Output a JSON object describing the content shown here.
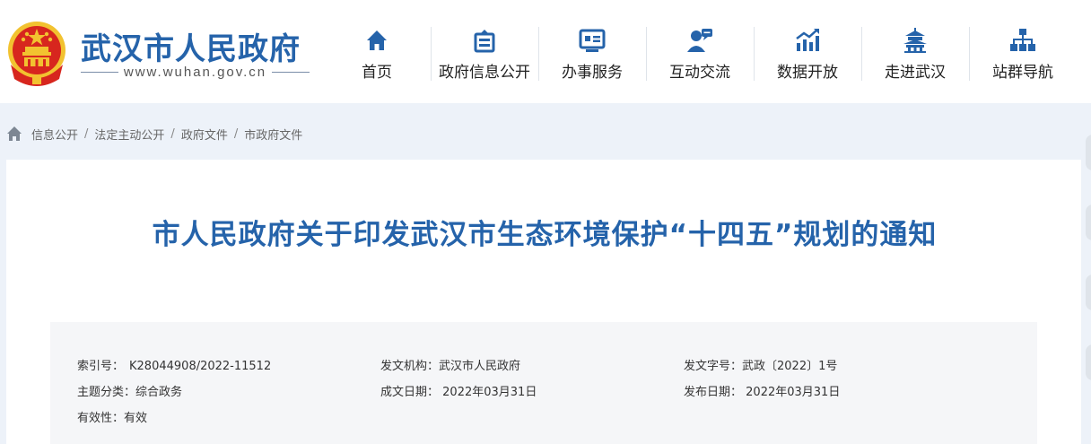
{
  "header": {
    "site_name": "武汉市人民政府",
    "site_url": "www.wuhan.gov.cn",
    "nav": [
      {
        "label": "首页",
        "icon": "home-icon"
      },
      {
        "label": "政府信息公开",
        "icon": "archive-icon"
      },
      {
        "label": "办事服务",
        "icon": "id-card-icon"
      },
      {
        "label": "互动交流",
        "icon": "user-chat-icon"
      },
      {
        "label": "数据开放",
        "icon": "bar-chart-icon"
      },
      {
        "label": "走进武汉",
        "icon": "pavilion-icon"
      },
      {
        "label": "站群导航",
        "icon": "sitemap-icon"
      }
    ]
  },
  "breadcrumb": {
    "items": [
      "信息公开",
      "法定主动公开",
      "政府文件",
      "市政府文件"
    ],
    "separator": "/"
  },
  "article": {
    "title": "市人民政府关于印发武汉市生态环境保护“十四五”规划的通知",
    "meta": [
      {
        "key": "索引号：",
        "value": "K28044908/2022-11512"
      },
      {
        "key": "发文机构：",
        "value": "武汉市人民政府"
      },
      {
        "key": "发文字号：",
        "value": "武政〔2022〕1号"
      },
      {
        "key": "主题分类：",
        "value": "综合政务"
      },
      {
        "key": "成文日期：",
        "value": " 2022年03月31日"
      },
      {
        "key": "发布日期：",
        "value": " 2022年03月31日"
      },
      {
        "key": "有效性：",
        "value": "有效"
      }
    ]
  },
  "colors": {
    "brand_blue": "#2563aa",
    "emblem_red": "#d7261e",
    "emblem_gold": "#f2c230",
    "page_bg": "#edf2f9"
  }
}
